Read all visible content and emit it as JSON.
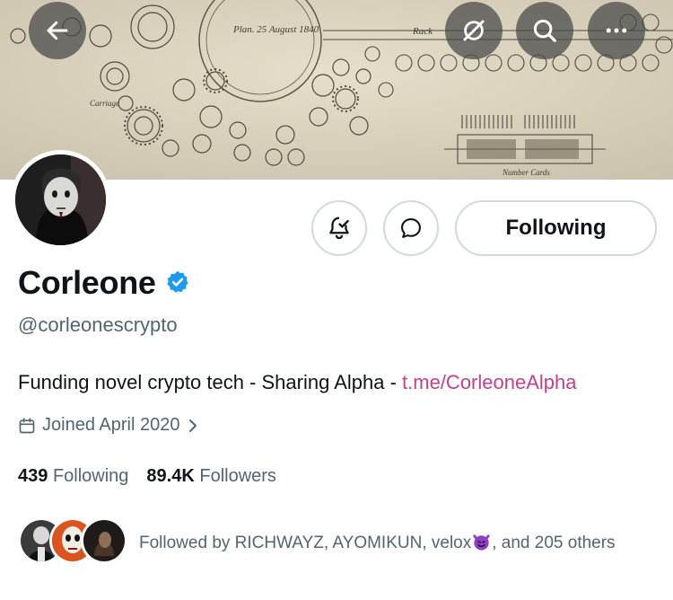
{
  "header": {
    "back_icon": "arrow-left-icon",
    "grok_icon": "grok-slash-icon",
    "search_icon": "search-icon",
    "more_icon": "more-horizontal-icon",
    "banner_text_top": "Plan. 25 August 1840",
    "banner_text_rack": "Rack",
    "banner_text_card": "Number Cards",
    "banner_text_carriage": "Carriage"
  },
  "actions": {
    "notify_icon": "bell-check-icon",
    "message_icon": "chat-bubble-icon",
    "following_label": "Following"
  },
  "profile": {
    "display_name": "Corleone",
    "verified_icon": "verified-badge-icon",
    "handle": "@corleonescrypto",
    "bio_text": "Funding novel crypto tech - Sharing Alpha - ",
    "bio_link": "t.me/CorleoneAlpha",
    "joined": "Joined April 2020",
    "following_count": "439",
    "following_label": "Following",
    "followers_count": "89.4K",
    "followers_label": "Followers"
  },
  "followed_by": {
    "text": "Followed by RICHWAYZ, AYOMIKUN, velox",
    "text_tail": ", and 205 others",
    "emoji_icon": "smiling-devil-icon"
  },
  "colors": {
    "accent_link": "#c2408f",
    "verified_blue": "#1d9bf0",
    "muted": "#536471",
    "border": "#cfd9de"
  }
}
